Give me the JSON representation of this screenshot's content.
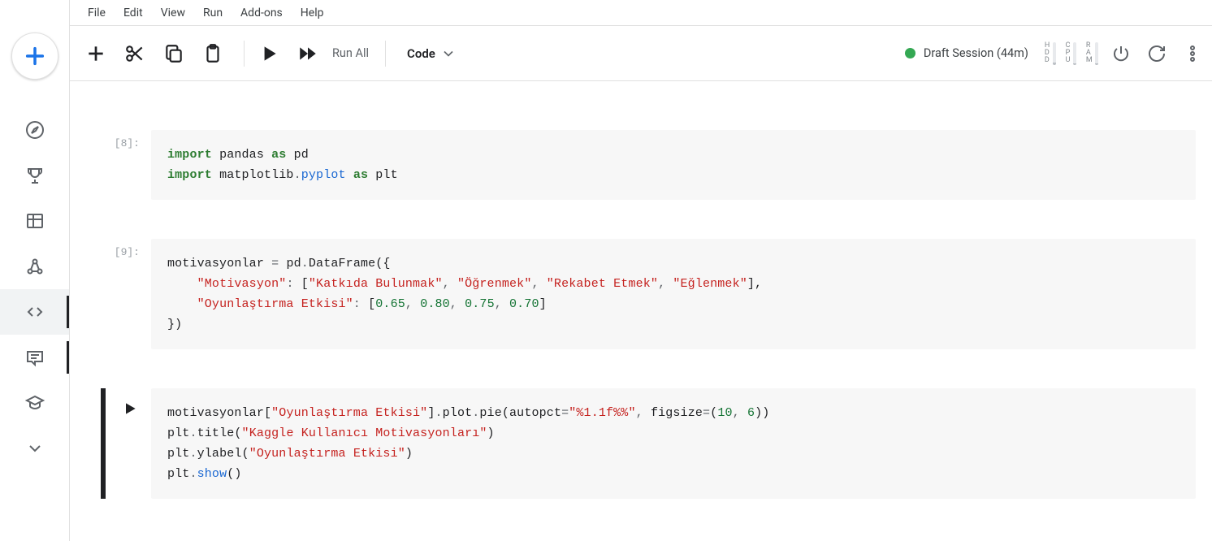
{
  "menu": {
    "file": "File",
    "edit": "Edit",
    "view": "View",
    "run": "Run",
    "addons": "Add-ons",
    "help": "Help"
  },
  "toolbar": {
    "run_all": "Run All",
    "cell_type": "Code",
    "session_label": "Draft Session (44m)"
  },
  "resources": {
    "hdd": "HDD",
    "cpu": "CPU",
    "ram": "RAM"
  },
  "cells": [
    {
      "prompt": "[8]:",
      "tokens": [
        {
          "t": "import ",
          "c": "kw"
        },
        {
          "t": "pandas ",
          "c": "id"
        },
        {
          "t": "as ",
          "c": "kw"
        },
        {
          "t": "pd",
          "c": "id"
        },
        {
          "t": "\n",
          "c": ""
        },
        {
          "t": "import ",
          "c": "kw"
        },
        {
          "t": "matplotlib",
          "c": "id"
        },
        {
          "t": ".",
          "c": "op"
        },
        {
          "t": "pyplot",
          "c": "mod"
        },
        {
          "t": " ",
          "c": ""
        },
        {
          "t": "as ",
          "c": "kw"
        },
        {
          "t": "plt",
          "c": "id"
        }
      ]
    },
    {
      "prompt": "[9]:",
      "tokens": [
        {
          "t": "motivasyonlar ",
          "c": "id"
        },
        {
          "t": "= ",
          "c": "op"
        },
        {
          "t": "pd",
          "c": "id"
        },
        {
          "t": ".",
          "c": "op"
        },
        {
          "t": "DataFrame",
          "c": "id"
        },
        {
          "t": "({",
          "c": "paren"
        },
        {
          "t": "\n",
          "c": ""
        },
        {
          "t": "    ",
          "c": ""
        },
        {
          "t": "\"Motivasyon\"",
          "c": "str"
        },
        {
          "t": ": ",
          "c": "op"
        },
        {
          "t": "[",
          "c": "paren"
        },
        {
          "t": "\"Katkıda Bulunmak\"",
          "c": "str"
        },
        {
          "t": ", ",
          "c": "op"
        },
        {
          "t": "\"Öğrenmek\"",
          "c": "str"
        },
        {
          "t": ", ",
          "c": "op"
        },
        {
          "t": "\"Rekabet Etmek\"",
          "c": "str"
        },
        {
          "t": ", ",
          "c": "op"
        },
        {
          "t": "\"Eğlenmek\"",
          "c": "str"
        },
        {
          "t": "],",
          "c": "paren"
        },
        {
          "t": "\n",
          "c": ""
        },
        {
          "t": "    ",
          "c": ""
        },
        {
          "t": "\"Oyunlaştırma Etkisi\"",
          "c": "str"
        },
        {
          "t": ": ",
          "c": "op"
        },
        {
          "t": "[",
          "c": "paren"
        },
        {
          "t": "0.65",
          "c": "num"
        },
        {
          "t": ", ",
          "c": "op"
        },
        {
          "t": "0.80",
          "c": "num"
        },
        {
          "t": ", ",
          "c": "op"
        },
        {
          "t": "0.75",
          "c": "num"
        },
        {
          "t": ", ",
          "c": "op"
        },
        {
          "t": "0.70",
          "c": "num"
        },
        {
          "t": "]",
          "c": "paren"
        },
        {
          "t": "\n",
          "c": ""
        },
        {
          "t": "})",
          "c": "paren"
        }
      ]
    },
    {
      "prompt": "",
      "focused": true,
      "tokens": [
        {
          "t": "motivasyonlar",
          "c": "id"
        },
        {
          "t": "[",
          "c": "paren"
        },
        {
          "t": "\"Oyunlaştırma Etkisi\"",
          "c": "str"
        },
        {
          "t": "]",
          "c": "paren"
        },
        {
          "t": ".",
          "c": "op"
        },
        {
          "t": "plot",
          "c": "id"
        },
        {
          "t": ".",
          "c": "op"
        },
        {
          "t": "pie",
          "c": "id"
        },
        {
          "t": "(",
          "c": "paren"
        },
        {
          "t": "autopct",
          "c": "id"
        },
        {
          "t": "=",
          "c": "op"
        },
        {
          "t": "\"%1.1f%%\"",
          "c": "str"
        },
        {
          "t": ", ",
          "c": "op"
        },
        {
          "t": "figsize",
          "c": "id"
        },
        {
          "t": "=",
          "c": "op"
        },
        {
          "t": "(",
          "c": "paren"
        },
        {
          "t": "10",
          "c": "num"
        },
        {
          "t": ", ",
          "c": "op"
        },
        {
          "t": "6",
          "c": "num"
        },
        {
          "t": "))",
          "c": "paren"
        },
        {
          "t": "\n",
          "c": ""
        },
        {
          "t": "plt",
          "c": "id"
        },
        {
          "t": ".",
          "c": "op"
        },
        {
          "t": "title",
          "c": "id"
        },
        {
          "t": "(",
          "c": "paren"
        },
        {
          "t": "\"Kaggle Kullanıcı Motivasyonları\"",
          "c": "str"
        },
        {
          "t": ")",
          "c": "paren"
        },
        {
          "t": "\n",
          "c": ""
        },
        {
          "t": "plt",
          "c": "id"
        },
        {
          "t": ".",
          "c": "op"
        },
        {
          "t": "ylabel",
          "c": "id"
        },
        {
          "t": "(",
          "c": "paren"
        },
        {
          "t": "\"Oyunlaştırma Etkisi\"",
          "c": "str"
        },
        {
          "t": ")",
          "c": "paren"
        },
        {
          "t": "\n",
          "c": ""
        },
        {
          "t": "plt",
          "c": "id"
        },
        {
          "t": ".",
          "c": "op"
        },
        {
          "t": "show",
          "c": "call"
        },
        {
          "t": "()",
          "c": "paren"
        }
      ]
    }
  ]
}
